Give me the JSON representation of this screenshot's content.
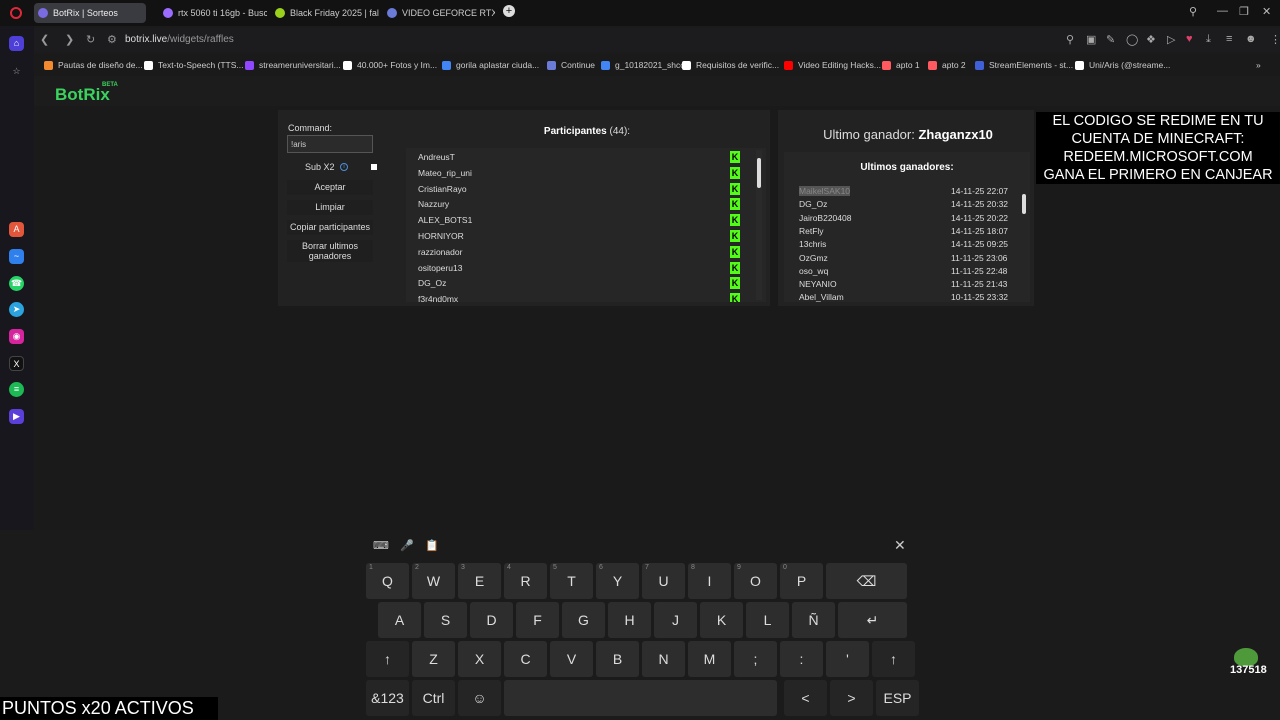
{
  "tabs": [
    {
      "title": "BotRix | Sorteos",
      "active": true,
      "color": "#7b6be0"
    },
    {
      "title": "rtx 5060 ti 16gb - Buscar con",
      "active": false,
      "color": "#9b6cff"
    },
    {
      "title": "Black Friday 2025 | falabella",
      "active": false,
      "color": "#9bd11d"
    },
    {
      "title": "VIDEO GEFORCE RTX 5060",
      "active": false,
      "color": "#6b7bd8"
    }
  ],
  "address": {
    "domain": "botrix.live",
    "path": "/widgets/raffles"
  },
  "bookmarks": [
    {
      "label": "Pautas de diseño de...",
      "color": "#f28b30"
    },
    {
      "label": "Text-to-Speech (TTS...",
      "color": "#fff"
    },
    {
      "label": "streameruniversitari...",
      "color": "#9146ff"
    },
    {
      "label": "40.000+ Fotos y Im...",
      "color": "#fff"
    },
    {
      "label": "gorila aplastar ciuda...",
      "color": "#4285f4"
    },
    {
      "label": "Continue",
      "color": "#6b7bd8"
    },
    {
      "label": "g_10182021_shcc",
      "color": "#4285f4"
    },
    {
      "label": "Requisitos de verific...",
      "color": "#fff"
    },
    {
      "label": "Video Editing Hacks...",
      "color": "#ff0000"
    },
    {
      "label": "apto 1",
      "color": "#ff5a5f"
    },
    {
      "label": "apto 2",
      "color": "#ff5a5f"
    },
    {
      "label": "StreamElements - st...",
      "color": "#4060d8"
    },
    {
      "label": "Uni/Aris (@streame...",
      "color": "#fff"
    }
  ],
  "logo": {
    "text": "BotRix",
    "beta": "BETA"
  },
  "raffle": {
    "command_label": "Command:",
    "command_value": "!aris",
    "sub_label": "Sub X2",
    "buttons": [
      "Aceptar",
      "Limpiar",
      "Copiar participantes",
      "Borrar ultimos ganadores"
    ],
    "participants_title": "Participantes",
    "participants_count": "(44):",
    "participants": [
      "AndreusT",
      "Mateo_rip_uni",
      "CristianRayo",
      "Nazzury",
      "ALEX_BOTS1",
      "HORNIYOR",
      "razzionador",
      "ositoperu13",
      "DG_Oz",
      "f3r4nd0mx"
    ]
  },
  "winners": {
    "last_label": "Ultimo ganador:",
    "last_name": "Zhaganzx10",
    "title": "Ultimos ganadores:",
    "list": [
      {
        "name": "MaikelSAK10",
        "date": "14-11-25 22:07"
      },
      {
        "name": "DG_Oz",
        "date": "14-11-25 20:32"
      },
      {
        "name": "JairoB220408",
        "date": "14-11-25 20:22"
      },
      {
        "name": "RetFly",
        "date": "14-11-25 18:07"
      },
      {
        "name": "13chris",
        "date": "14-11-25 09:25"
      },
      {
        "name": "OzGmz",
        "date": "11-11-25 23:06"
      },
      {
        "name": "oso_wq",
        "date": "11-11-25 22:48"
      },
      {
        "name": "NEYANIO",
        "date": "11-11-25 21:43"
      },
      {
        "name": "Abel_Villam",
        "date": "10-11-25 23:32"
      }
    ]
  },
  "overlay": {
    "lines": [
      "EL CODIGO SE REDIME EN TU",
      "CUENTA DE MINECRAFT:",
      "REDEEM.MICROSOFT.COM",
      "GANA EL PRIMERO EN CANJEAR"
    ]
  },
  "keyboard": {
    "row1": [
      {
        "k": "Q",
        "n": "1"
      },
      {
        "k": "W",
        "n": "2"
      },
      {
        "k": "E",
        "n": "3"
      },
      {
        "k": "R",
        "n": "4"
      },
      {
        "k": "T",
        "n": "5"
      },
      {
        "k": "Y",
        "n": "6"
      },
      {
        "k": "U",
        "n": "7"
      },
      {
        "k": "I",
        "n": "8"
      },
      {
        "k": "O",
        "n": "9"
      },
      {
        "k": "P",
        "n": "0"
      }
    ],
    "row2": [
      "A",
      "S",
      "D",
      "F",
      "G",
      "H",
      "J",
      "K",
      "L",
      "Ñ"
    ],
    "row3": [
      "Z",
      "X",
      "C",
      "V",
      "B",
      "N",
      "M",
      ";",
      ":",
      "'"
    ],
    "ctrl_label": "Ctrl",
    "sym_label": "&123",
    "lang_label": "ESP"
  },
  "puntos": "PUNTOS x20 ACTIVOS",
  "frog_count": "137518"
}
